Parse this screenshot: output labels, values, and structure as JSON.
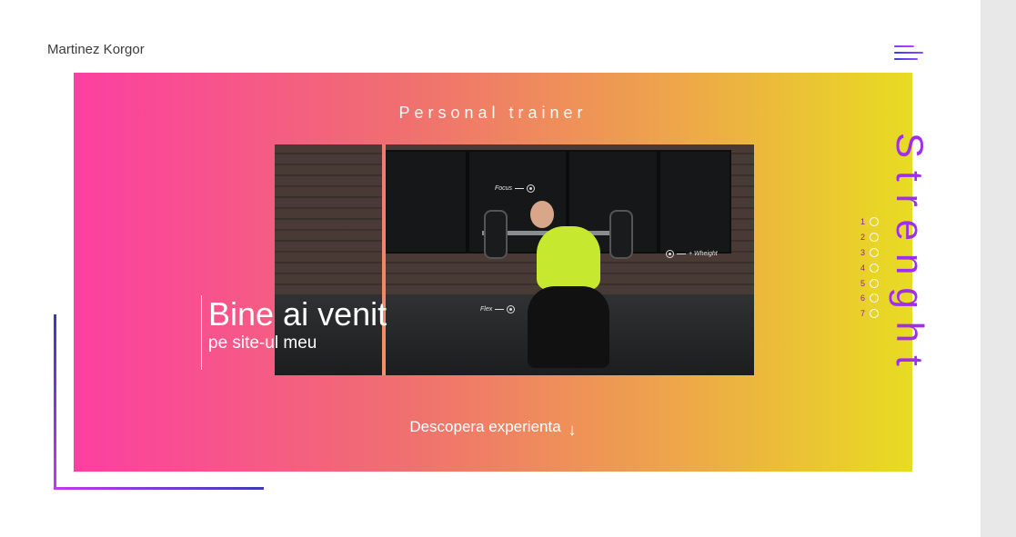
{
  "header": {
    "brand": "Martinez Korgor",
    "menu_icon": "hamburger-icon"
  },
  "hero": {
    "title": "Personal trainer",
    "welcome_title": "Bine ai venit",
    "welcome_subtitle": "pe site-ul meu",
    "cta_label": "Descopera experienta",
    "cta_arrow": "↓"
  },
  "annotations": {
    "focus": "Focus",
    "weight": "+ Wheight",
    "flex": "Flex"
  },
  "pager": {
    "items": [
      "1",
      "2",
      "3",
      "4",
      "5",
      "6",
      "7"
    ]
  },
  "side_word": "Strenght",
  "colors": {
    "gradient_start": "#fc3fa1",
    "gradient_end": "#e8dc22",
    "accent_purple": "#a02ef0",
    "accent_blue": "#3a3ab8"
  }
}
